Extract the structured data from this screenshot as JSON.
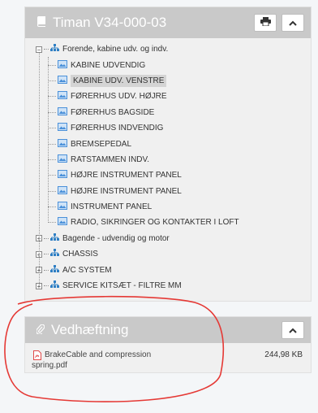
{
  "vehicle_panel": {
    "title": "Timan V34-000-03",
    "icons": {
      "title": "book-icon",
      "print": "print-icon",
      "collapse": "chevron-up-icon"
    },
    "root": {
      "label": "Forende, kabine udv. og indv.",
      "children": [
        "KABINE UDVENDIG",
        "KABINE UDV. VENSTRE",
        "FØRERHUS UDV. HØJRE",
        "FØRERHUS BAGSIDE",
        "FØRERHUS INDVENDIG",
        "BREMSEPEDAL",
        "RATSTAMMEN INDV.",
        "HØJRE INSTRUMENT PANEL",
        "HØJRE INSTRUMENT PANEL",
        "INSTRUMENT PANEL",
        "RADIO, SIKRINGER OG KONTAKTER I LOFT"
      ],
      "selected_index": 1
    },
    "groups": [
      "Bagende - udvendig og motor",
      "CHASSIS",
      "A/C SYSTEM",
      "SERVICE KITSÆT - FILTRE MM"
    ],
    "expand_symbol": "+",
    "collapse_symbol": "−"
  },
  "attachment_panel": {
    "title": "Vedhæftning",
    "icons": {
      "title": "paperclip-icon",
      "file": "pdf-file-icon",
      "collapse": "chevron-up-icon"
    },
    "file_name": "BrakeCable and compression spring.pdf",
    "file_size": "244,98 KB"
  },
  "colors": {
    "header": "#c9c9c9",
    "folder_icon": "#2f7fc4",
    "image_icon": "#4a90d9",
    "pdf_icon": "#e04a4a",
    "annotation": "#e53935"
  }
}
